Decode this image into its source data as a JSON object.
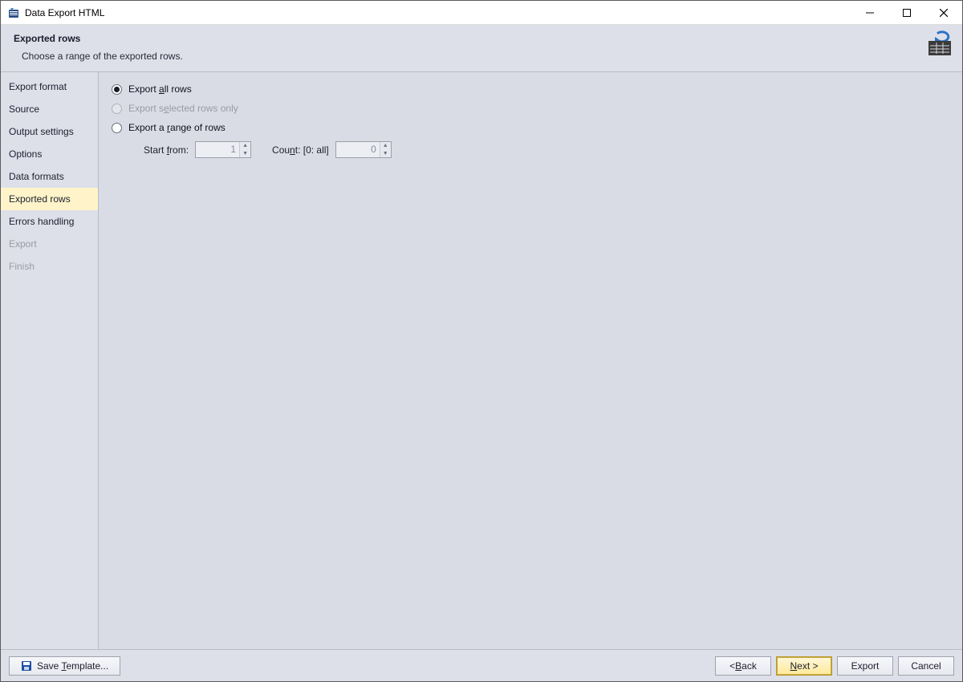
{
  "window": {
    "title": "Data Export HTML"
  },
  "header": {
    "title": "Exported rows",
    "description": "Choose a range of the exported rows."
  },
  "sidebar": {
    "items": [
      {
        "label": "Export format",
        "state": "normal"
      },
      {
        "label": "Source",
        "state": "normal"
      },
      {
        "label": "Output settings",
        "state": "normal"
      },
      {
        "label": "Options",
        "state": "normal"
      },
      {
        "label": "Data formats",
        "state": "normal"
      },
      {
        "label": "Exported rows",
        "state": "selected"
      },
      {
        "label": "Errors handling",
        "state": "normal"
      },
      {
        "label": "Export",
        "state": "disabled"
      },
      {
        "label": "Finish",
        "state": "disabled"
      }
    ]
  },
  "options": {
    "export_all": {
      "label_pre": "Export ",
      "label_u": "a",
      "label_post": "ll rows",
      "checked": true,
      "enabled": true
    },
    "export_selected": {
      "label_pre": "Export s",
      "label_u": "e",
      "label_post": "lected rows only",
      "checked": false,
      "enabled": false
    },
    "export_range": {
      "label_pre": "Export a ",
      "label_u": "r",
      "label_post": "ange of rows",
      "checked": false,
      "enabled": true
    },
    "start_from": {
      "label_pre": "Start ",
      "label_u": "f",
      "label_post": "rom:",
      "value": "1"
    },
    "count": {
      "label_pre": "Cou",
      "label_u": "n",
      "label_post": "t: [0: all]",
      "value": "0"
    }
  },
  "footer": {
    "save_template": {
      "pre": "Save ",
      "u": "T",
      "post": "emplate..."
    },
    "back": {
      "pre": "< ",
      "u": "B",
      "post": "ack"
    },
    "next": {
      "u": "N",
      "post": "ext >"
    },
    "export": "Export",
    "cancel": "Cancel"
  }
}
